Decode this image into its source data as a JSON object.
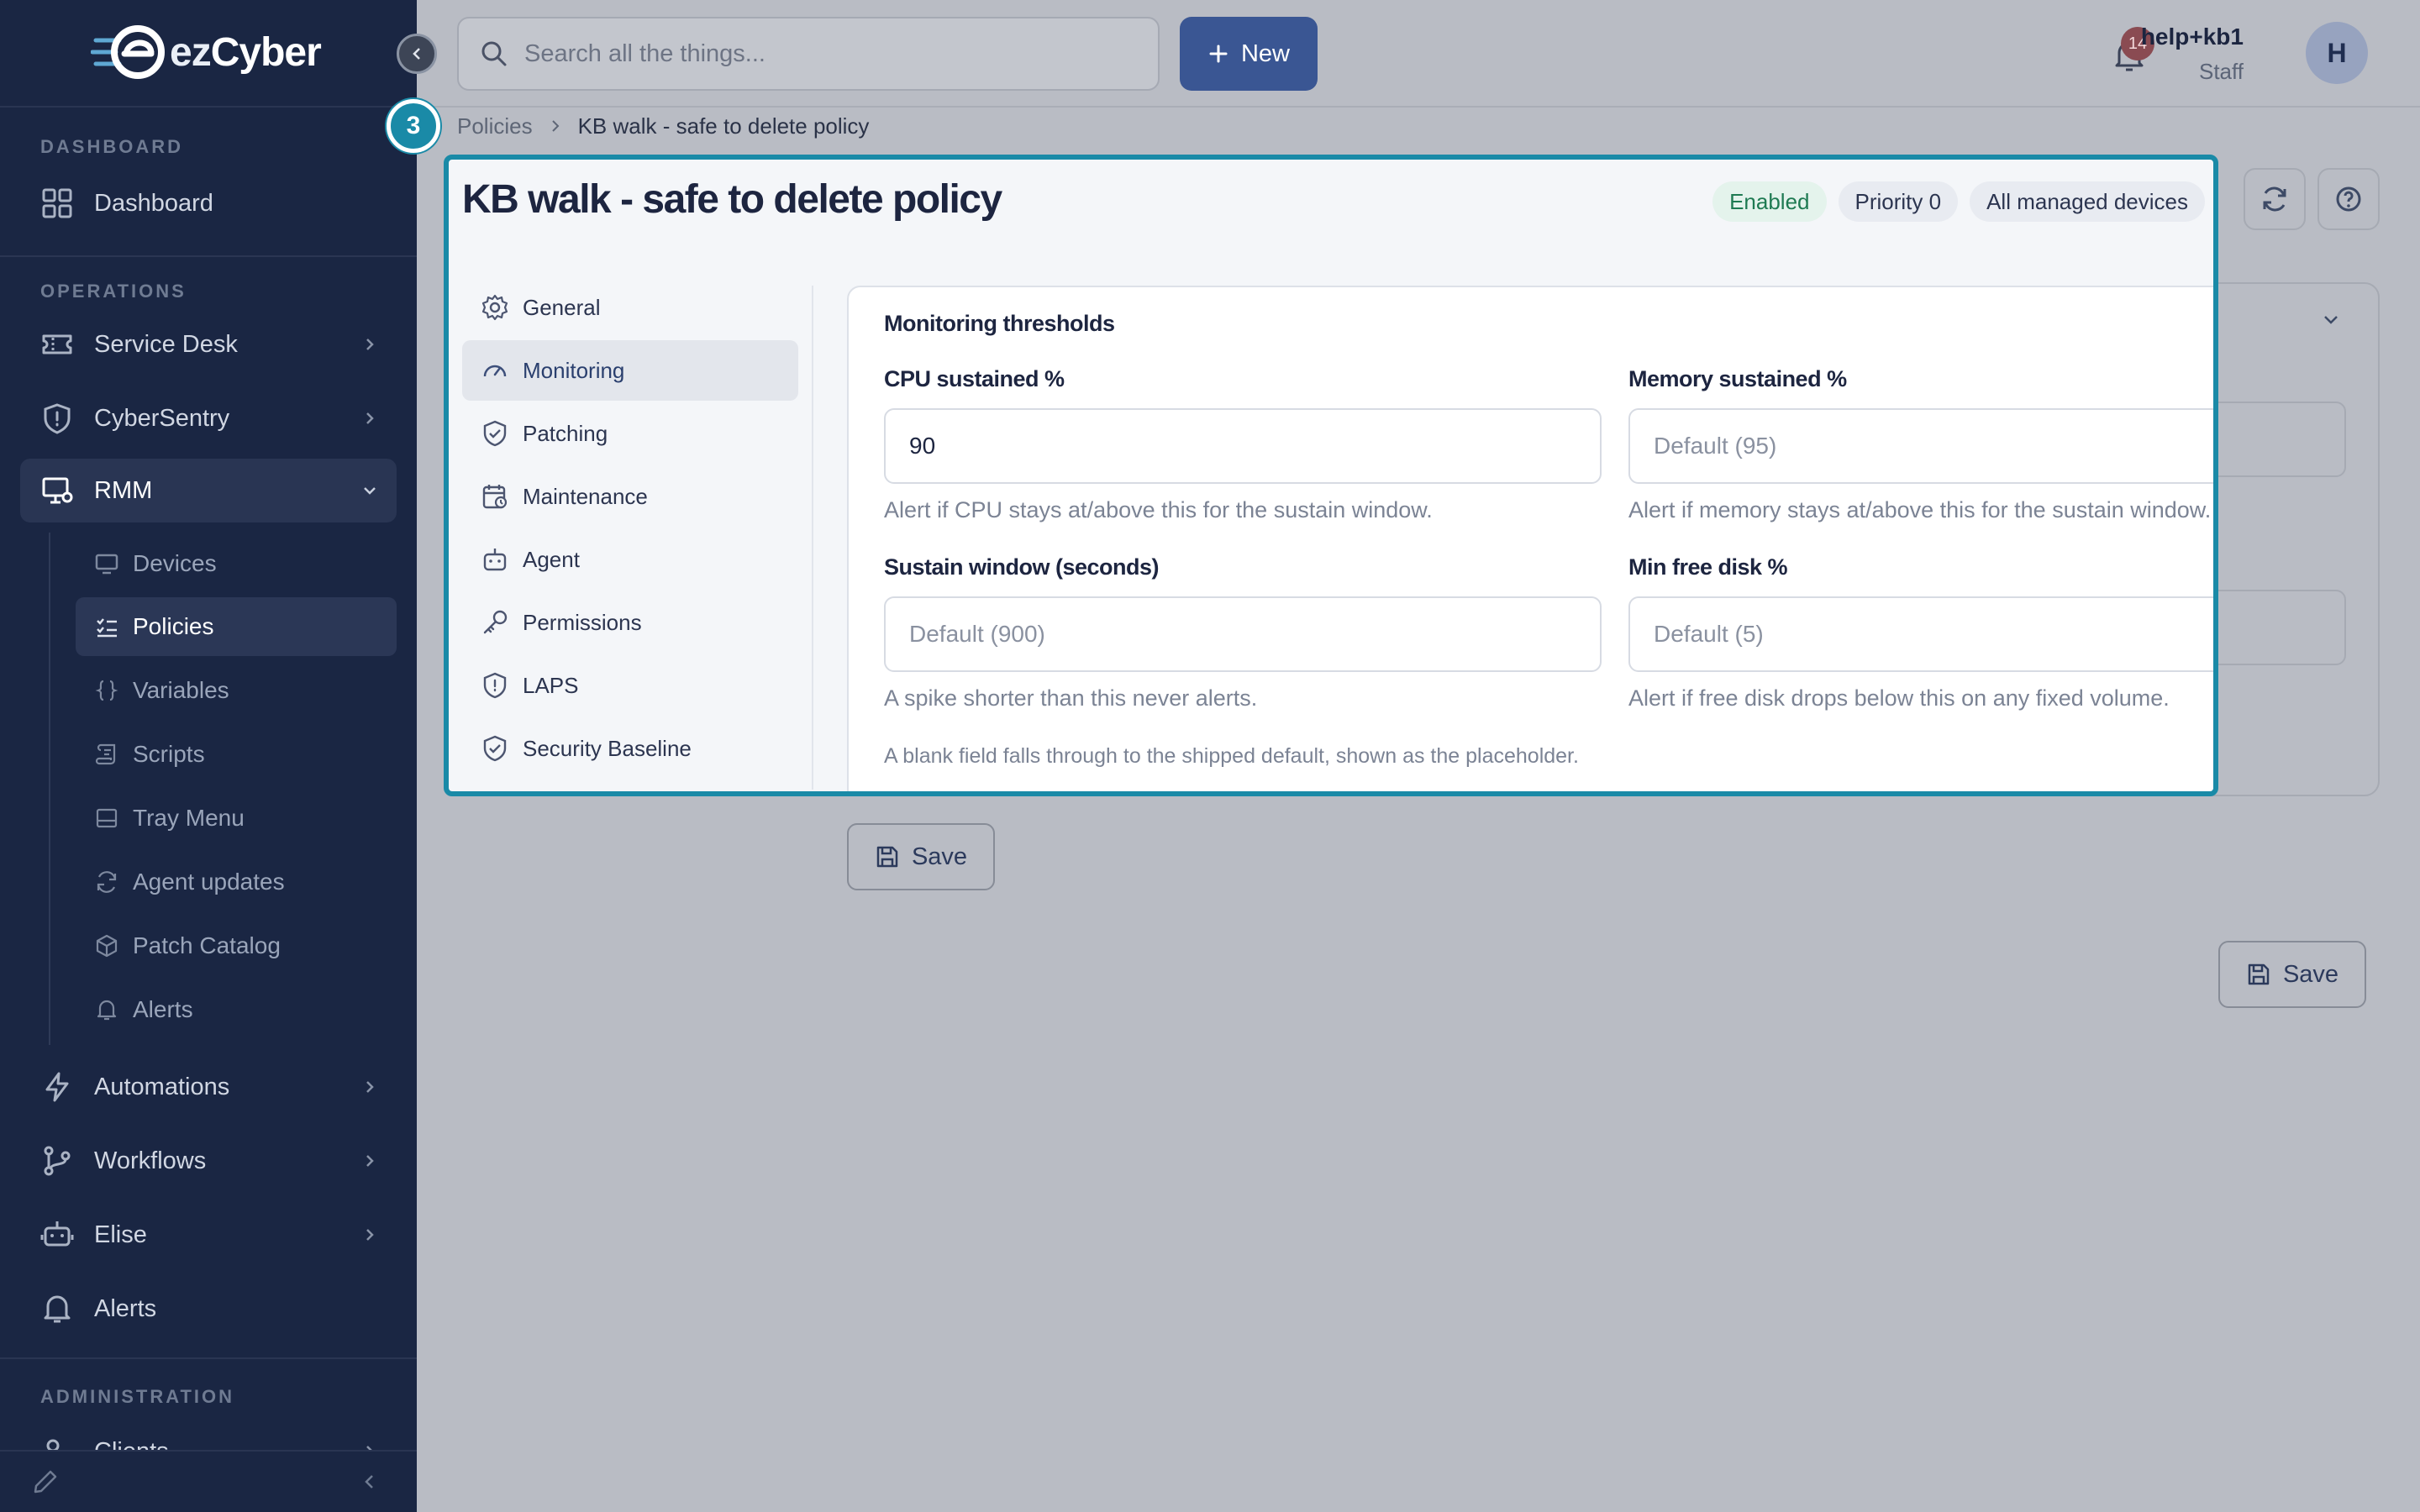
{
  "app": {
    "logo_text_main": "ez",
    "logo_text_brand": "Cyber"
  },
  "sidebar": {
    "sections": {
      "dashboard": "DASHBOARD",
      "operations": "OPERATIONS",
      "administration": "ADMINISTRATION"
    },
    "items": {
      "dashboard": "Dashboard",
      "service_desk": "Service Desk",
      "cybersentry": "CyberSentry",
      "rmm": "RMM",
      "automations": "Automations",
      "workflows": "Workflows",
      "elise": "Elise",
      "alerts": "Alerts",
      "clients": "Clients"
    },
    "rmm_sub": {
      "devices": "Devices",
      "policies": "Policies",
      "variables": "Variables",
      "scripts": "Scripts",
      "tray_menu": "Tray Menu",
      "agent_updates": "Agent updates",
      "patch_catalog": "Patch Catalog",
      "alerts": "Alerts"
    }
  },
  "topbar": {
    "search_placeholder": "Search all the things...",
    "new_label": "New",
    "notification_count": "14",
    "user_name": "help+kb1",
    "user_role": "Staff",
    "avatar_initial": "H"
  },
  "breadcrumb": {
    "root": "Policies",
    "current": "KB walk - safe to delete policy"
  },
  "step_badge": "3",
  "policy": {
    "title": "KB walk - safe to delete policy",
    "chips": {
      "status": "Enabled",
      "priority": "Priority 0",
      "scope": "All managed devices"
    },
    "tabs": {
      "general": "General",
      "monitoring": "Monitoring",
      "patching": "Patching",
      "maintenance": "Maintenance",
      "agent": "Agent",
      "permissions": "Permissions",
      "laps": "LAPS",
      "security_baseline": "Security Baseline"
    }
  },
  "monitoring": {
    "section_title": "Monitoring thresholds",
    "cpu": {
      "label": "CPU sustained %",
      "value": "90",
      "help": "Alert if CPU stays at/above this for the sustain window."
    },
    "memory": {
      "label": "Memory sustained %",
      "placeholder": "Default (95)",
      "help": "Alert if memory stays at/above this for the sustain window."
    },
    "sustain": {
      "label": "Sustain window (seconds)",
      "placeholder": "Default (900)",
      "help": "A spike shorter than this never alerts."
    },
    "disk": {
      "label": "Min free disk %",
      "placeholder": "Default (5)",
      "help": "Alert if free disk drops below this on any fixed volume."
    },
    "note": "A blank field falls through to the shipped default, shown as the placeholder."
  },
  "actions": {
    "save_label": "Save"
  },
  "colors": {
    "sidebar_bg": "#1a2643",
    "accent": "#3a5693",
    "highlight": "#1a8aa7",
    "enabled": "#1e7a52"
  }
}
